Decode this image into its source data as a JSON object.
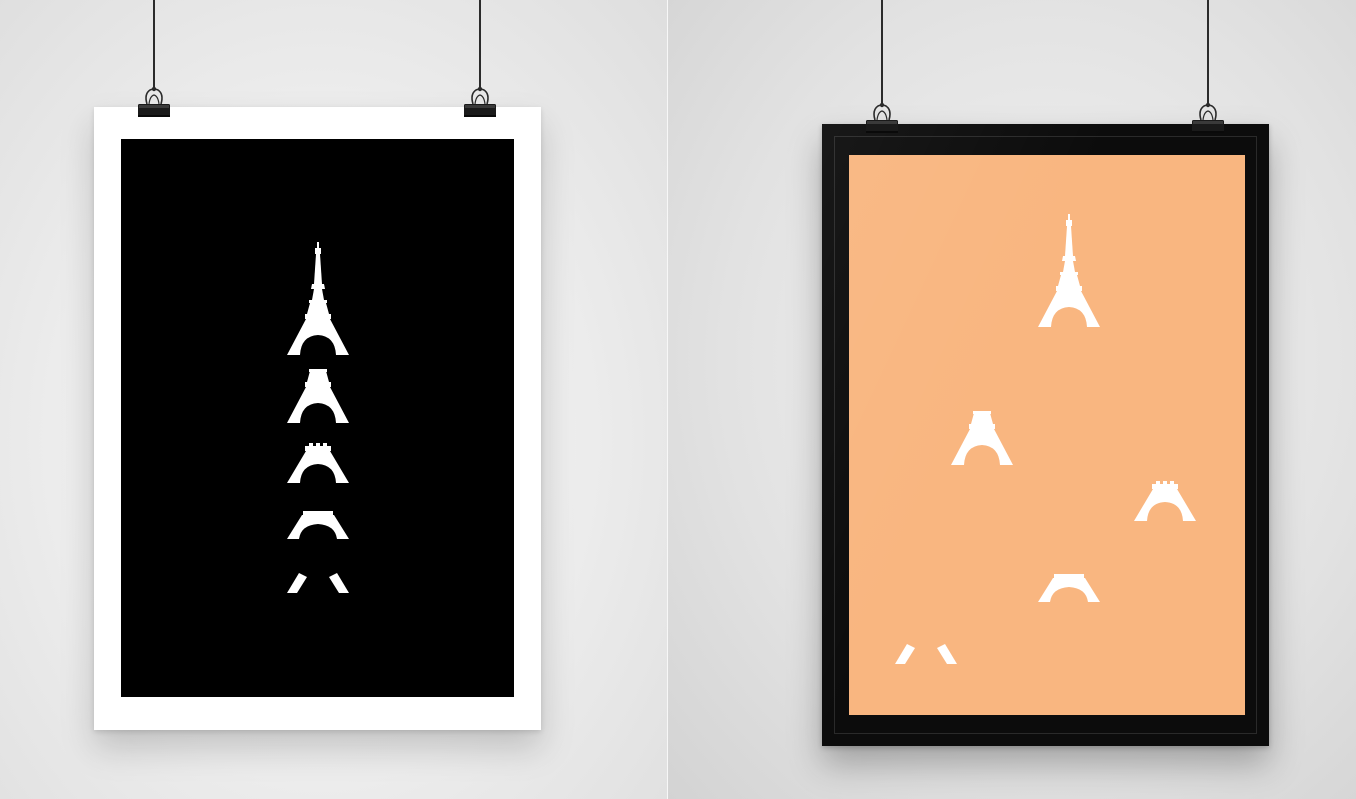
{
  "scene": {
    "description_colors": {
      "wall_light": "#f3f3f3",
      "wall_shadow": "#d3d3d3",
      "clip": "#1a1a1a",
      "wire": "#2b2b2b"
    }
  },
  "posters": [
    {
      "frame_color": "#ffffff",
      "art_background": "#000000",
      "tower_color": "#ffffff",
      "tower_pieces": [
        "tower-full",
        "tower-lower-two-levels",
        "tower-lower-mid",
        "tower-base-arch",
        "tower-feet"
      ]
    },
    {
      "frame_color": "#0c0c0c",
      "art_background": "#f9b680",
      "tower_color": "#ffffff",
      "tower_pieces": [
        "tower-full",
        "tower-lower-two-levels",
        "tower-lower-mid",
        "tower-base-arch",
        "tower-feet"
      ]
    }
  ]
}
